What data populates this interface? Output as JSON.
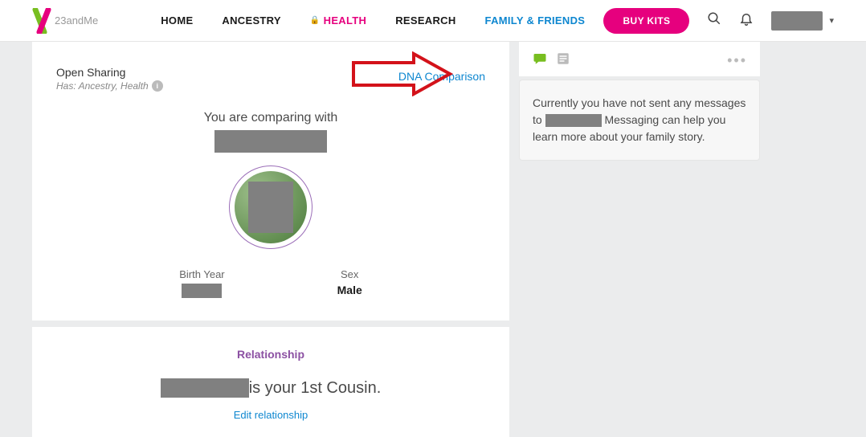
{
  "brand": "23andMe",
  "nav": {
    "home": "HOME",
    "ancestry": "ANCESTRY",
    "health": "HEALTH",
    "research": "RESEARCH",
    "friends": "FAMILY & FRIENDS"
  },
  "header": {
    "buy": "BUY KITS"
  },
  "profile": {
    "open_sharing": "Open Sharing",
    "has": "Has: Ancestry, Health",
    "dna_comparison": "DNA Comparison",
    "comparing_with": "You are comparing with",
    "birth_year_label": "Birth Year",
    "sex_label": "Sex",
    "sex_value": "Male"
  },
  "relationship": {
    "title": "Relationship",
    "statement_suffix": "is your 1st Cousin.",
    "edit": "Edit relationship"
  },
  "messages": {
    "prefix": "Currently you have not sent any messages to",
    "suffix": "Messaging can help you learn more about your family story."
  }
}
